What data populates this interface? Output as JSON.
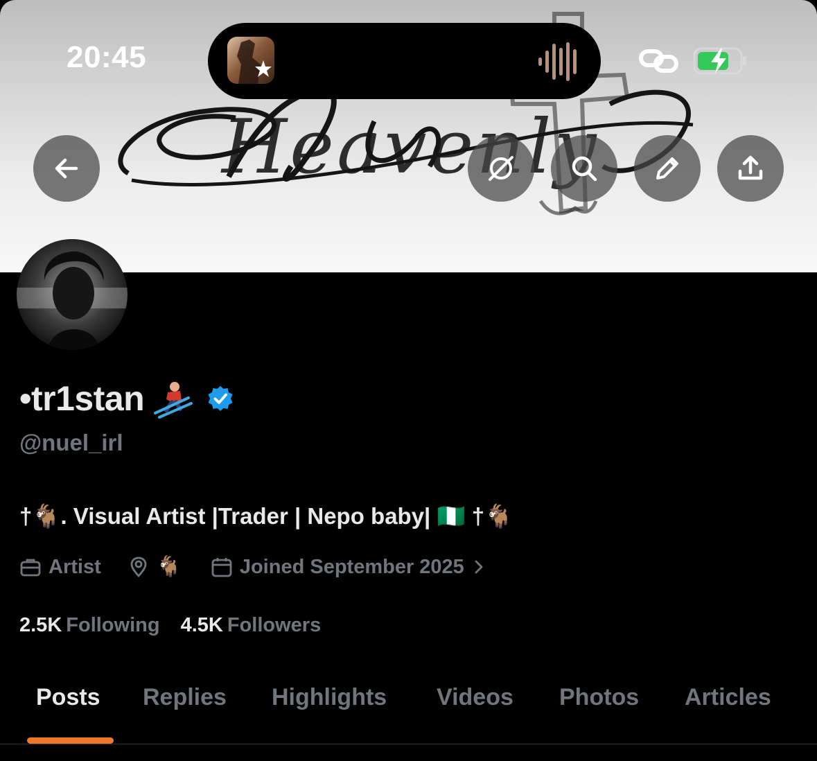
{
  "status_bar": {
    "time": "20:45",
    "battery_charging": true,
    "link_icon": "link-icon",
    "audio_icon": "waveform-icon"
  },
  "banner": {
    "script_text": "Heavenly"
  },
  "header_actions": [
    {
      "name": "back",
      "icon": "arrow-left-icon"
    },
    {
      "name": "grok",
      "icon": "grok-icon"
    },
    {
      "name": "search",
      "icon": "search-icon"
    },
    {
      "name": "edit",
      "icon": "pencil-icon"
    },
    {
      "name": "share",
      "icon": "share-icon"
    }
  ],
  "profile": {
    "display_name": "•tr1stan",
    "name_emoji": "skier-emoji",
    "verified": true,
    "handle": "@nuel_irl",
    "bio": "†🐐. Visual Artist |Trader | Nepo baby| 🇳🇬 †🐐",
    "category": "Artist",
    "location": "🐐",
    "joined": "Joined September 2025",
    "following_count": "2.5K",
    "following_label": "Following",
    "followers_count": "4.5K",
    "followers_label": "Followers"
  },
  "tabs": [
    {
      "label": "Posts",
      "active": true
    },
    {
      "label": "Replies",
      "active": false
    },
    {
      "label": "Highlights",
      "active": false
    },
    {
      "label": "Videos",
      "active": false
    },
    {
      "label": "Photos",
      "active": false
    },
    {
      "label": "Articles",
      "active": false
    }
  ],
  "colors": {
    "background": "#000000",
    "primary_text": "#e7e9ea",
    "secondary_text": "#71767b",
    "verified_blue": "#1d9bf0",
    "tab_indicator": "#f0772a",
    "battery_green": "#34c759"
  }
}
